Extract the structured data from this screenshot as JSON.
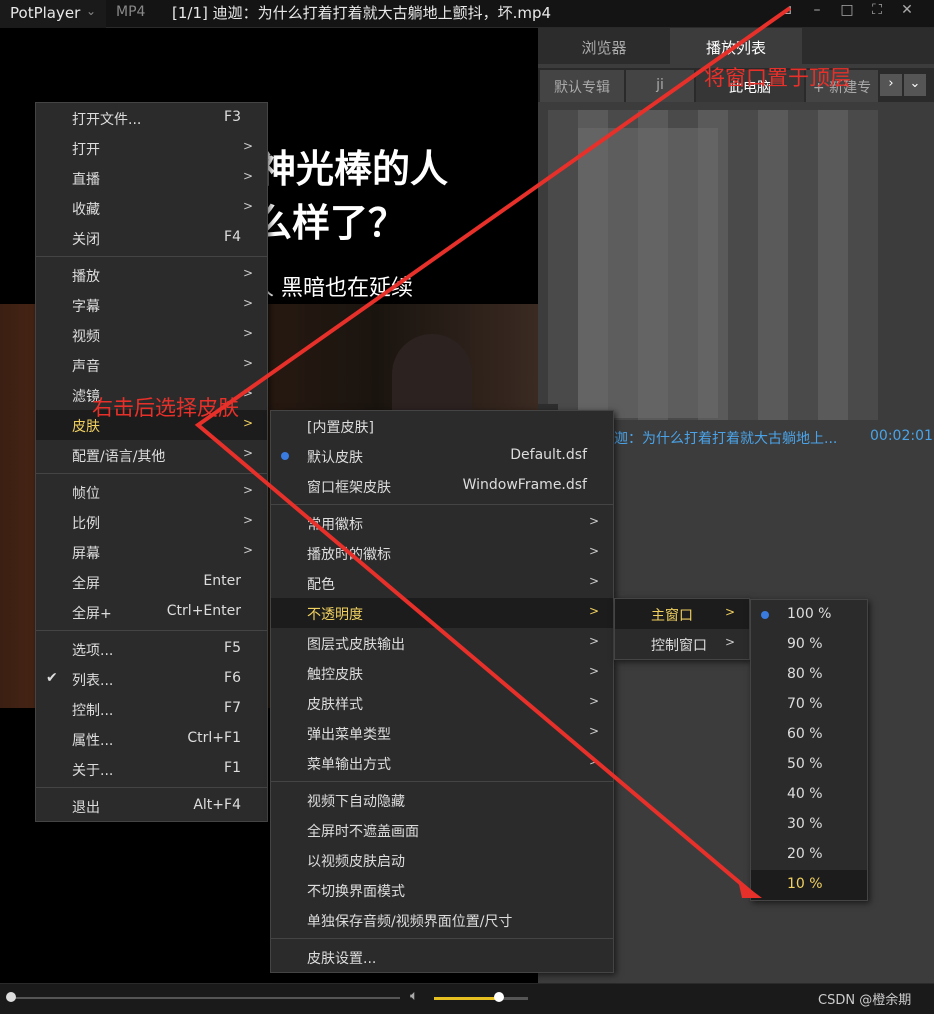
{
  "titlebar": {
    "app_name": "PotPlayer",
    "format": "MP4",
    "filename": "[1/1] 迪迦：为什么打着打着就大古躺地上颤抖，坏.mp4"
  },
  "video": {
    "subtitle_line1": "神光棒的人",
    "subtitle_line2": "么样了？",
    "subtitle_line3": "人 黑暗也在延续"
  },
  "panel": {
    "tabs": [
      "浏览器",
      "播放列表"
    ],
    "subtabs": [
      "默认专辑",
      "ji",
      "此电脑",
      "+ 新建专"
    ],
    "playlist_item": {
      "title": "迦：为什么打着打着就大古躺地上...",
      "duration": "00:02:01"
    }
  },
  "menu_main": [
    {
      "label": "打开文件...",
      "shortcut": "F3"
    },
    {
      "label": "打开",
      "arrow": ">"
    },
    {
      "label": "直播",
      "arrow": ">"
    },
    {
      "label": "收藏",
      "arrow": ">"
    },
    {
      "label": "关闭",
      "shortcut": "F4"
    },
    {
      "label": "播放",
      "arrow": ">"
    },
    {
      "label": "字幕",
      "arrow": ">"
    },
    {
      "label": "视频",
      "arrow": ">"
    },
    {
      "label": "声音",
      "arrow": ">"
    },
    {
      "label": "滤镜",
      "arrow": ">"
    },
    {
      "label": "皮肤",
      "arrow": ">"
    },
    {
      "label": "配置/语言/其他",
      "arrow": ">"
    },
    {
      "label": "帧位",
      "arrow": ">"
    },
    {
      "label": "比例",
      "arrow": ">"
    },
    {
      "label": "屏幕",
      "arrow": ">"
    },
    {
      "label": "全屏",
      "shortcut": "Enter"
    },
    {
      "label": "全屏+",
      "shortcut": "Ctrl+Enter"
    },
    {
      "label": "选项...",
      "shortcut": "F5"
    },
    {
      "label": "列表...",
      "shortcut": "F6",
      "checked": "✔"
    },
    {
      "label": "控制...",
      "shortcut": "F7"
    },
    {
      "label": "属性...",
      "shortcut": "Ctrl+F1"
    },
    {
      "label": "关于...",
      "shortcut": "F1"
    },
    {
      "label": "退出",
      "shortcut": "Alt+F4"
    }
  ],
  "menu_skin": [
    {
      "label": "[内置皮肤]"
    },
    {
      "label": "默认皮肤",
      "shortcut": "Default.dsf"
    },
    {
      "label": "窗口框架皮肤",
      "shortcut": "WindowFrame.dsf"
    },
    {
      "label": "常用徽标",
      "arrow": ">"
    },
    {
      "label": "播放时的徽标",
      "arrow": ">"
    },
    {
      "label": "配色",
      "arrow": ">"
    },
    {
      "label": "不透明度",
      "arrow": ">"
    },
    {
      "label": "图层式皮肤输出",
      "arrow": ">"
    },
    {
      "label": "触控皮肤",
      "arrow": ">"
    },
    {
      "label": "皮肤样式",
      "arrow": ">"
    },
    {
      "label": "弹出菜单类型",
      "arrow": ">"
    },
    {
      "label": "菜单输出方式",
      "arrow": ">"
    },
    {
      "label": "视频下自动隐藏"
    },
    {
      "label": "全屏时不遮盖画面"
    },
    {
      "label": "以视频皮肤启动"
    },
    {
      "label": "不切换界面模式"
    },
    {
      "label": "单独保存音频/视频界面位置/尺寸"
    },
    {
      "label": "皮肤设置..."
    }
  ],
  "menu_window": [
    {
      "label": "主窗口",
      "arrow": ">"
    },
    {
      "label": "控制窗口",
      "arrow": ">"
    }
  ],
  "menu_opacity": [
    "100 %",
    "90 %",
    "80 %",
    "70 %",
    "60 %",
    "50 %",
    "40 %",
    "30 %",
    "20 %",
    "10 %"
  ],
  "annotations": {
    "right_click_note": "右击后选择皮肤",
    "top_note": "将窗口置于顶层"
  },
  "watermark": "CSDN @橙余期",
  "colors": {
    "highlight": "#f0d060",
    "annotation": "#e8302a",
    "radio": "#3a7be0",
    "link": "#4aa3e8"
  }
}
